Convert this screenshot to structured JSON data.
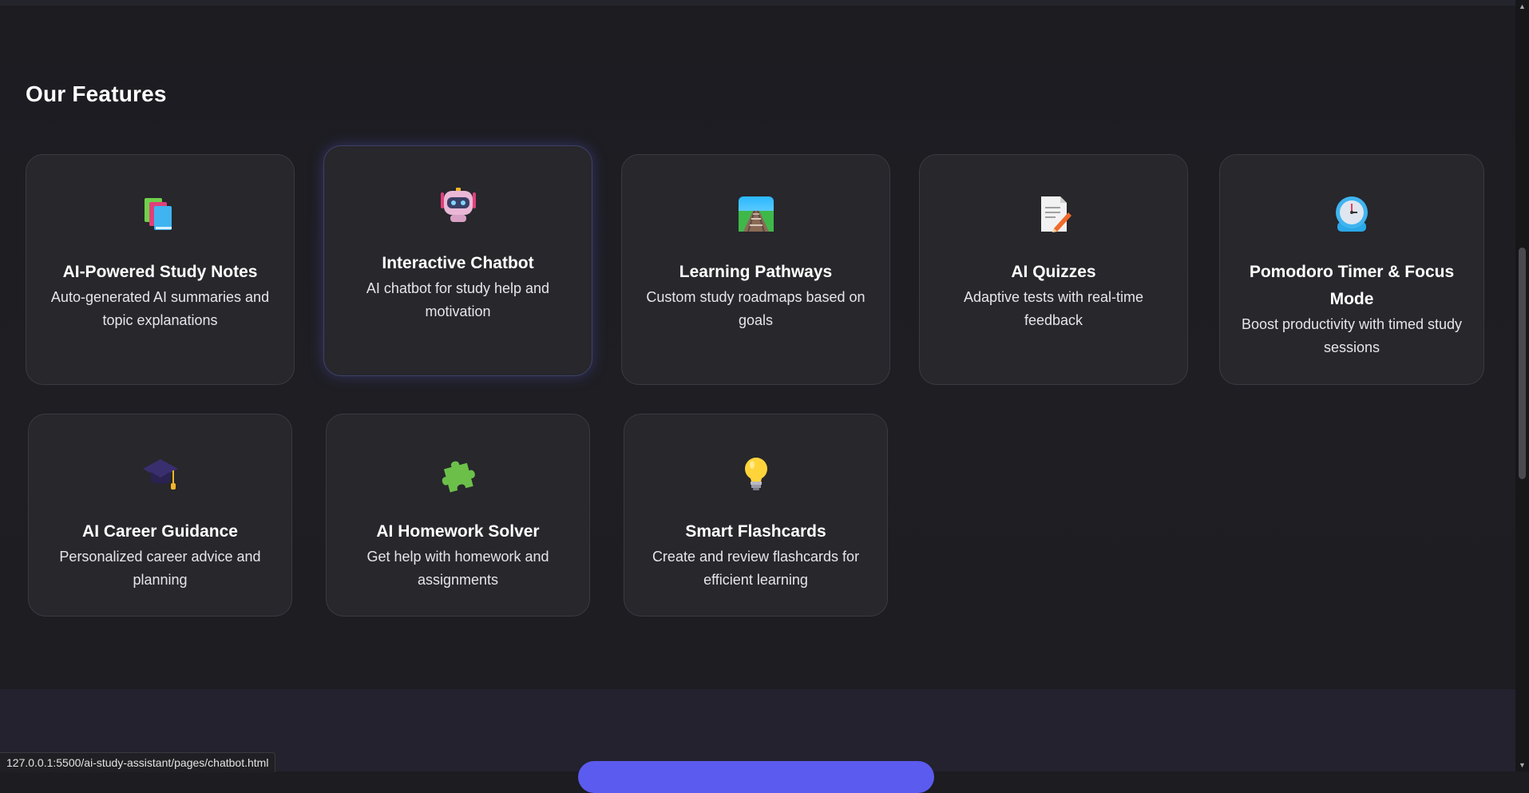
{
  "features": {
    "title": "Our Features",
    "cards": [
      {
        "icon": "books-icon",
        "title": "AI-Powered Study Notes",
        "desc": "Auto-generated AI summaries and topic explanations"
      },
      {
        "icon": "robot-icon",
        "title": "Interactive Chatbot",
        "desc": "AI chatbot for study help and motivation"
      },
      {
        "icon": "railway-track-icon",
        "title": "Learning Pathways",
        "desc": "Custom study roadmaps based on goals"
      },
      {
        "icon": "memo-icon",
        "title": "AI Quizzes",
        "desc": "Adaptive tests with real-time feedback"
      },
      {
        "icon": "stopwatch-icon",
        "title": "Pomodoro Timer & Focus Mode",
        "desc": "Boost productivity with timed study sessions"
      },
      {
        "icon": "graduation-cap-icon",
        "title": "AI Career Guidance",
        "desc": "Personalized career advice and planning"
      },
      {
        "icon": "puzzle-piece-icon",
        "title": "AI Homework Solver",
        "desc": "Get help with homework and assignments"
      },
      {
        "icon": "light-bulb-icon",
        "title": "Smart Flashcards",
        "desc": "Create and review flashcards for efficient learning"
      }
    ]
  },
  "status_bar": {
    "url": "127.0.0.1:5500/ai-study-assistant/pages/chatbot.html"
  },
  "colors": {
    "background": "#1c1c21",
    "card": "#27272c",
    "card_border": "#3a3a42",
    "accent": "#5b5bf0"
  }
}
